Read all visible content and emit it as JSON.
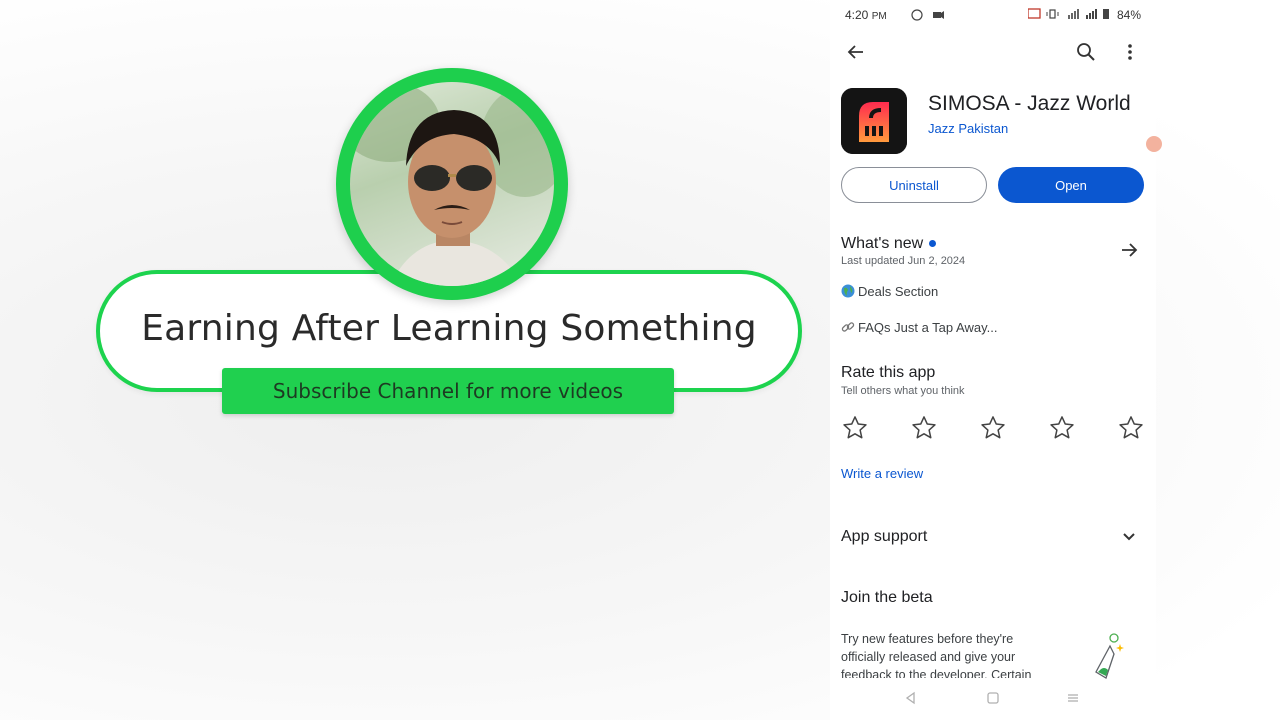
{
  "promo": {
    "title": "Earning After Learning Something",
    "subscribe": "Subscribe Channel for more videos"
  },
  "status_bar": {
    "time": "4:20",
    "ampm": "PM",
    "battery": "84%"
  },
  "toolbar": {
    "back_icon": "arrow-left-icon",
    "search_icon": "search-icon",
    "menu_icon": "more-vert-icon"
  },
  "app": {
    "title": "SIMOSA - Jazz World",
    "developer": "Jazz Pakistan",
    "uninstall_label": "Uninstall",
    "open_label": "Open",
    "brand_color": "#0b57d0"
  },
  "whats_new": {
    "heading": "What's new",
    "updated": "Last updated Jun 2, 2024",
    "items": [
      "Deals Section",
      "FAQs Just a Tap Away..."
    ]
  },
  "rate": {
    "heading": "Rate this app",
    "sub": "Tell others what you think",
    "stars": 5,
    "write_review": "Write a review"
  },
  "support": {
    "heading": "App support"
  },
  "beta": {
    "heading": "Join the beta",
    "text": "Try new features before they're officially released and give your feedback to the developer. Certain"
  }
}
